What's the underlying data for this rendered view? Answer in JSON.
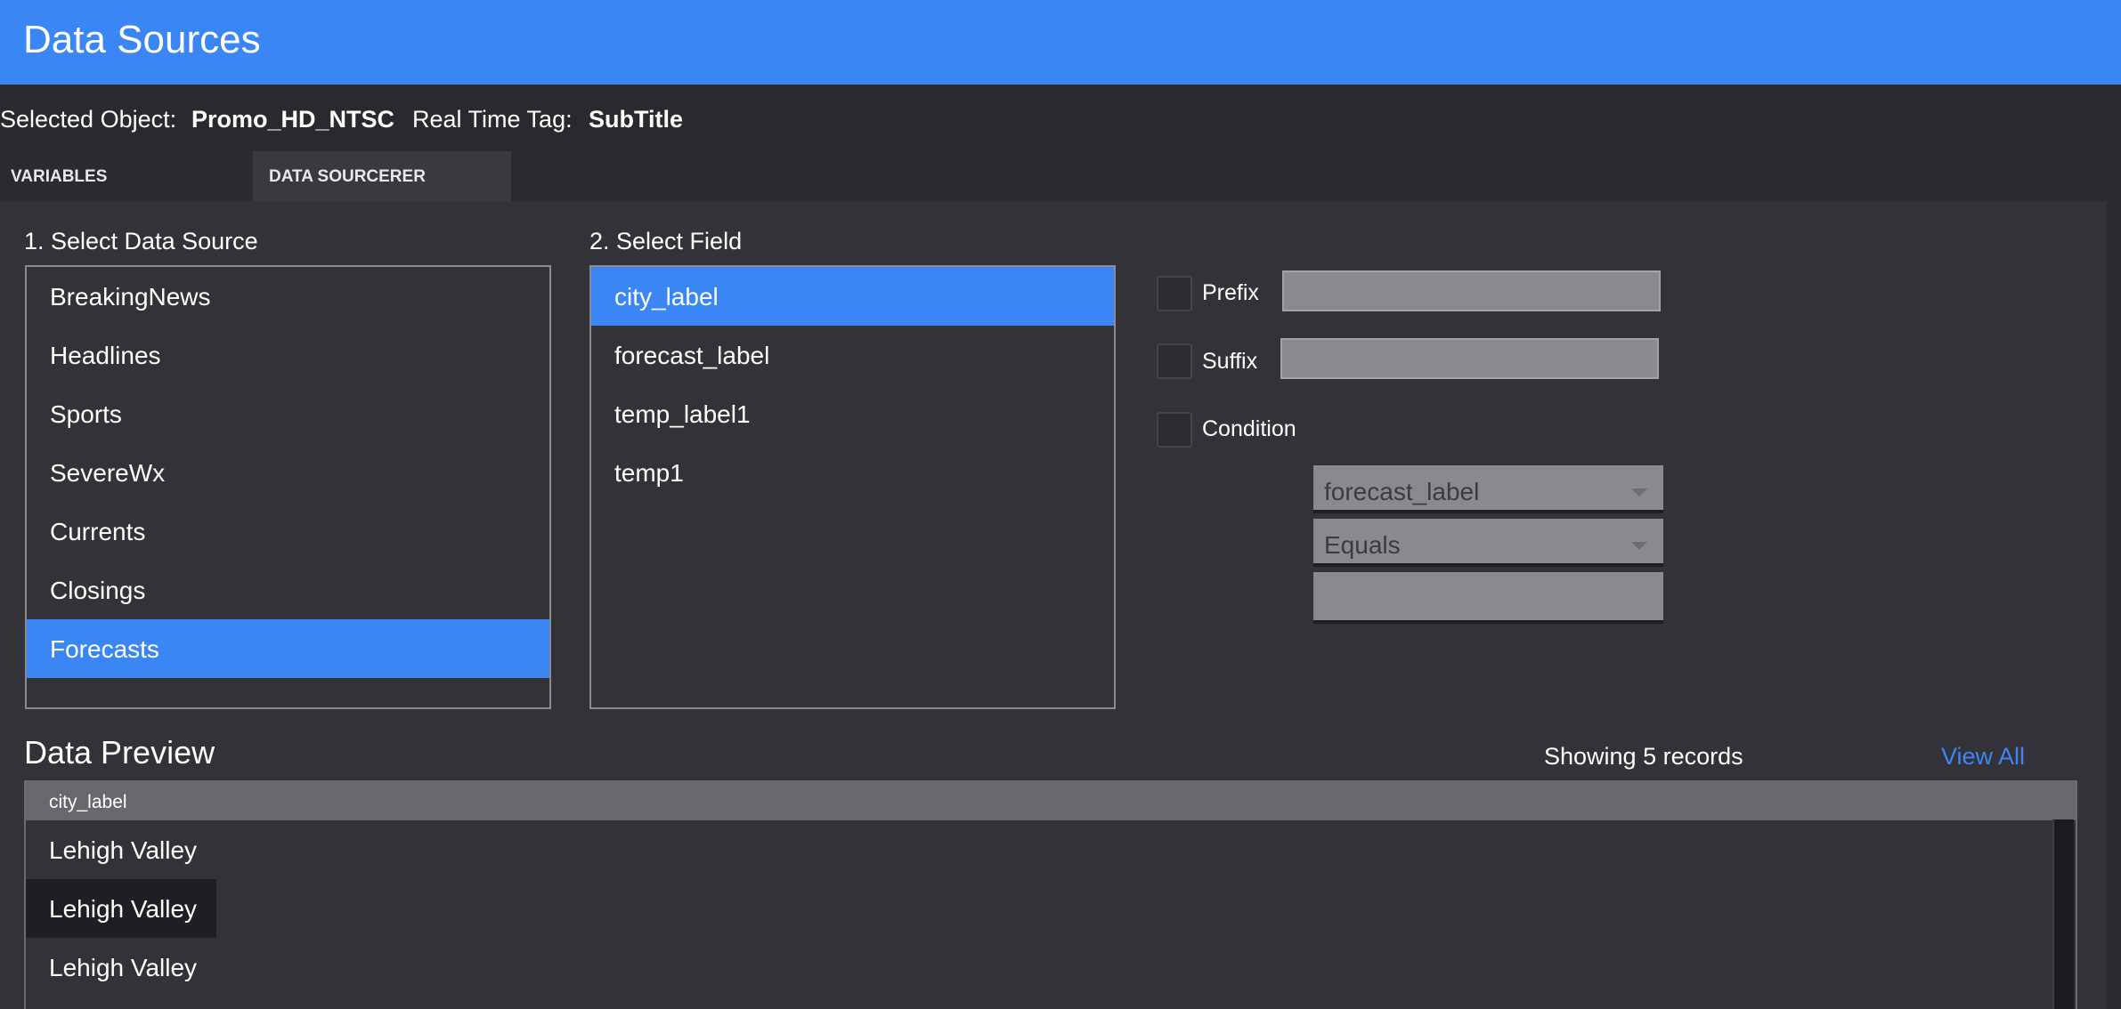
{
  "window": {
    "title": "Data Sources"
  },
  "info": {
    "selected_object_label": "Selected Object:",
    "selected_object_value": "Promo_HD_NTSC",
    "realtime_tag_label": "Real Time Tag:",
    "realtime_tag_value": "SubTitle"
  },
  "tabs": [
    {
      "label": "VARIABLES",
      "active": false
    },
    {
      "label": "DATA SOURCERER",
      "active": true
    }
  ],
  "step1": {
    "label": "1. Select Data Source",
    "items": [
      "BreakingNews",
      "Headlines",
      "Sports",
      "SevereWx",
      "Currents",
      "Closings",
      "Forecasts"
    ],
    "selected": "Forecasts"
  },
  "step2": {
    "label": "2. Select Field",
    "items": [
      "city_label",
      "forecast_label",
      "temp_label1",
      "temp1"
    ],
    "selected": "city_label"
  },
  "options": {
    "prefix_label": "Prefix",
    "suffix_label": "Suffix",
    "condition_label": "Condition",
    "condition_field": "forecast_label",
    "condition_operator": "Equals",
    "condition_value": ""
  },
  "preview": {
    "title": "Data Preview",
    "records_text": "Showing 5 records",
    "view_all": "View All",
    "column": "city_label",
    "rows": [
      "Lehigh Valley",
      "Lehigh Valley",
      "Lehigh Valley"
    ]
  },
  "colors": {
    "accent": "#3a86f4",
    "background": "#2b2a2f",
    "panel": "#333238"
  }
}
